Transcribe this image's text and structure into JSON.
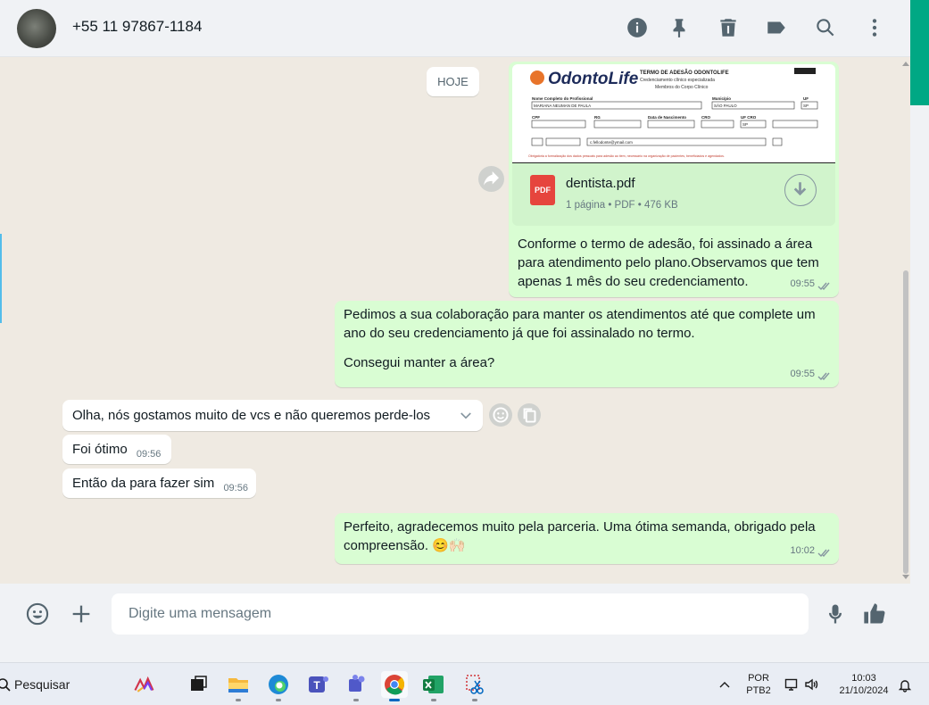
{
  "header": {
    "contact_name": "+55 11 97867-1184",
    "icons": [
      "info-icon",
      "pin-icon",
      "delete-icon",
      "label-icon",
      "search-icon",
      "menu-icon"
    ]
  },
  "chat": {
    "date_chip": "HOJE",
    "pdf_message": {
      "file_name": "dentista.pdf",
      "file_type_badge": "PDF",
      "file_info": "1 página • PDF • 476 KB",
      "preview": {
        "brand": "OdontoLife",
        "form_title": "TERMO DE ADESÃO ODONTOLIFE",
        "form_subtitle_1": "Credenciamento clínico especializada",
        "form_subtitle_2": "Membros do Corpo Clínico",
        "field_name_label": "Nome Completo do Profissional",
        "field_name_value": "MARIANA NEUMAN DE PAULA",
        "field_city_label": "Município",
        "field_city_value": "SÃO PAULO",
        "field_state_label": "UF",
        "field_state_value": "SP",
        "field_cpf_label": "CPF",
        "field_rg_label": "RG",
        "field_birth_label": "Data de Nascimento",
        "field_cro_label": "CRO",
        "field_uf_cro_label": "UF CRO",
        "field_cro_uf_value": "SP",
        "field_email_value": "c.fellodonte@ymail.com",
        "footer_note": "Obrigatória a formalização dos dados pessoais para adesão ao item, necessário na organização de pacientes, beneficiados e agendados."
      },
      "caption": "Conforme o termo de adesão, foi assinado a área para atendimento pelo plano.Observamos que tem apenas 1 mês do seu credenciamento.",
      "time": "09:55"
    },
    "out_message_2": {
      "line_1": "Pedimos a sua colaboração para manter os atendimentos até que complete um ano do seu credenciamento já que foi assinalado no termo.",
      "line_2": "Consegui manter a área?",
      "time": "09:55"
    },
    "in_messages": [
      {
        "text": "Olha, nós gostamos muito de vcs e não queremos perde-los",
        "time": ""
      },
      {
        "text": "Foi ótimo",
        "time": "09:56"
      },
      {
        "text": "Então da para fazer sim",
        "time": "09:56"
      }
    ],
    "out_message_3": {
      "text": "Perfeito, agradecemos muito pela parceria. Uma ótima semanda, obrigado pela compreensão. 😊🙌🏻",
      "time": "10:02"
    }
  },
  "composer": {
    "placeholder": "Digite uma mensagem"
  },
  "taskbar": {
    "search_label": "Pesquisar",
    "language": "POR",
    "keyboard": "PTB2",
    "time": "10:03",
    "date": "21/10/2024"
  }
}
